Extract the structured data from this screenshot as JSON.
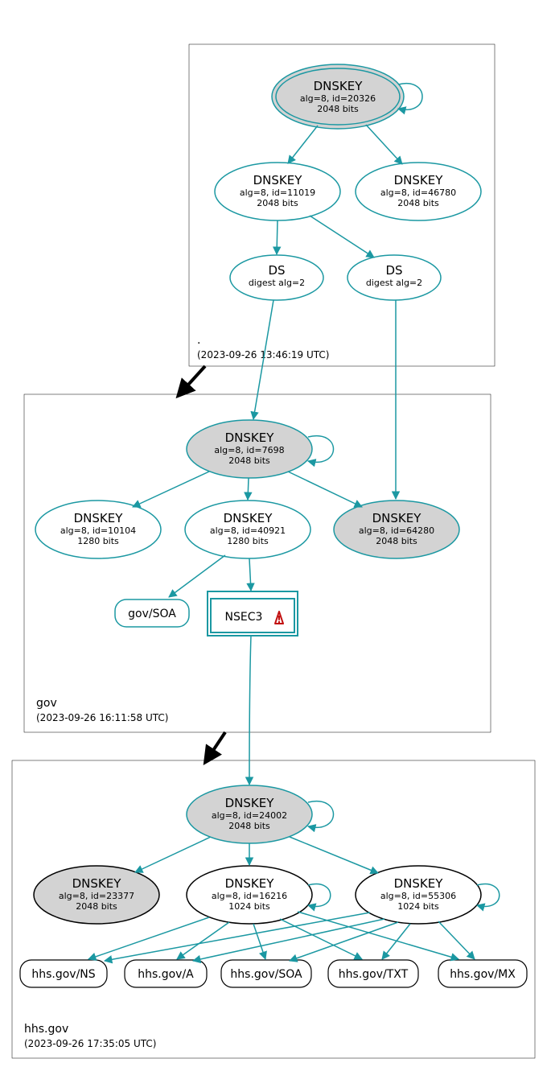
{
  "zones": {
    "root": {
      "label": ".",
      "timestamp": "(2023-09-26 13:46:19 UTC)",
      "nodes": {
        "ksk": {
          "title": "DNSKEY",
          "line1": "alg=8, id=20326",
          "line2": "2048 bits"
        },
        "zsk1": {
          "title": "DNSKEY",
          "line1": "alg=8, id=11019",
          "line2": "2048 bits"
        },
        "zsk2": {
          "title": "DNSKEY",
          "line1": "alg=8, id=46780",
          "line2": "2048 bits"
        },
        "ds1": {
          "title": "DS",
          "line1": "digest alg=2"
        },
        "ds2": {
          "title": "DS",
          "line1": "digest alg=2"
        }
      }
    },
    "gov": {
      "label": "gov",
      "timestamp": "(2023-09-26 16:11:58 UTC)",
      "nodes": {
        "ksk": {
          "title": "DNSKEY",
          "line1": "alg=8, id=7698",
          "line2": "2048 bits"
        },
        "zsk1": {
          "title": "DNSKEY",
          "line1": "alg=8, id=10104",
          "line2": "1280 bits"
        },
        "zsk2": {
          "title": "DNSKEY",
          "line1": "alg=8, id=40921",
          "line2": "1280 bits"
        },
        "zsk3": {
          "title": "DNSKEY",
          "line1": "alg=8, id=64280",
          "line2": "2048 bits"
        },
        "soa": {
          "title": "gov/SOA"
        },
        "nsec3": {
          "title": "NSEC3"
        }
      }
    },
    "hhs": {
      "label": "hhs.gov",
      "timestamp": "(2023-09-26 17:35:05 UTC)",
      "nodes": {
        "ksk": {
          "title": "DNSKEY",
          "line1": "alg=8, id=24002",
          "line2": "2048 bits"
        },
        "zsk1": {
          "title": "DNSKEY",
          "line1": "alg=8, id=23377",
          "line2": "2048 bits"
        },
        "zsk2": {
          "title": "DNSKEY",
          "line1": "alg=8, id=16216",
          "line2": "1024 bits"
        },
        "zsk3": {
          "title": "DNSKEY",
          "line1": "alg=8, id=55306",
          "line2": "1024 bits"
        },
        "rec1": {
          "title": "hhs.gov/NS"
        },
        "rec2": {
          "title": "hhs.gov/A"
        },
        "rec3": {
          "title": "hhs.gov/SOA"
        },
        "rec4": {
          "title": "hhs.gov/TXT"
        },
        "rec5": {
          "title": "hhs.gov/MX"
        }
      }
    }
  }
}
